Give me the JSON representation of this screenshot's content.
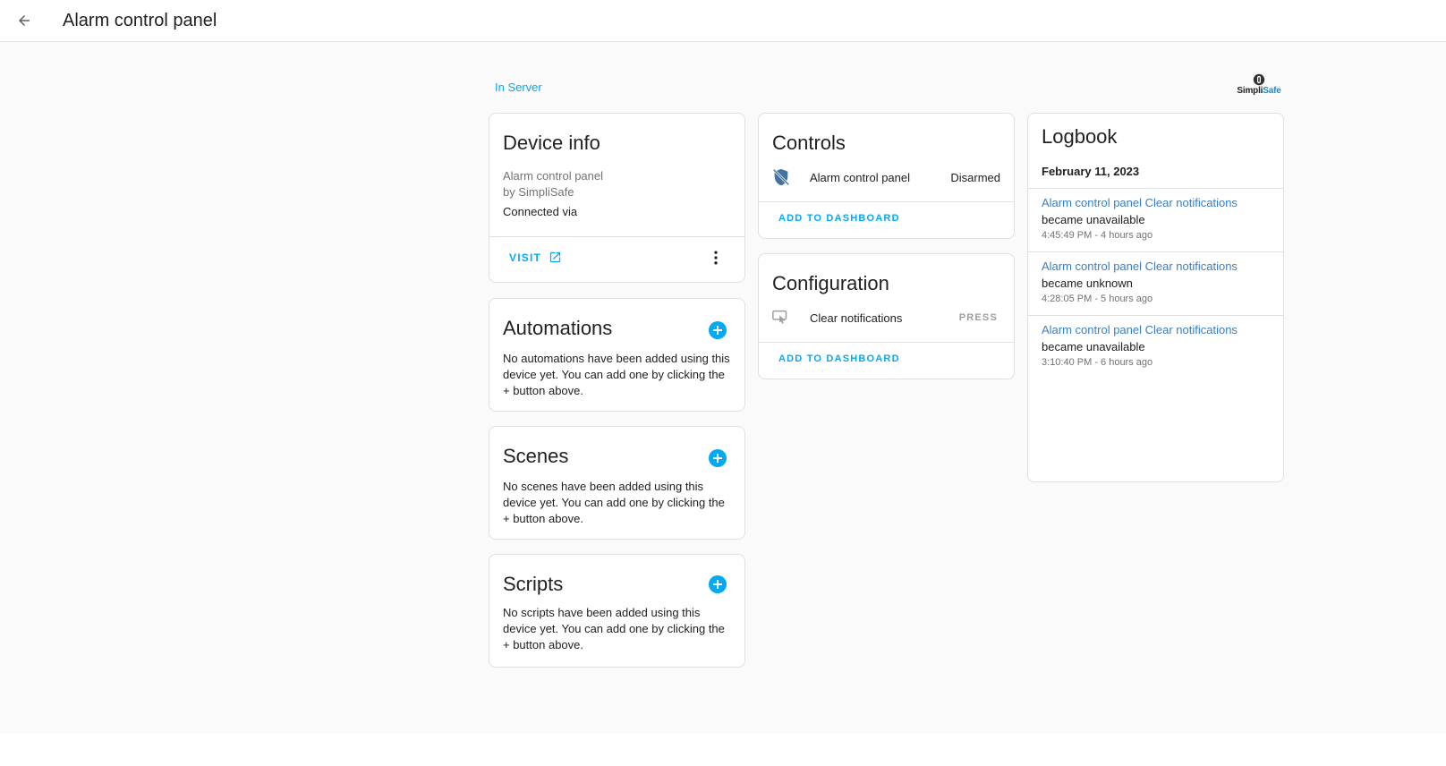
{
  "header": {
    "title": "Alarm control panel"
  },
  "area_link": "In Server",
  "brand": {
    "name_part1": "Simpli",
    "name_part2": "Safe",
    "accent_color": "#1e88c8"
  },
  "device_info": {
    "title": "Device info",
    "model": "Alarm control panel",
    "manufacturer": "by SimpliSafe",
    "connected_via": "Connected via",
    "visit_label": "VISIT"
  },
  "automations": {
    "title": "Automations",
    "empty_text": "No automations have been added using this device yet. You can add one by clicking the + button above."
  },
  "scenes": {
    "title": "Scenes",
    "empty_text": "No scenes have been added using this device yet. You can add one by clicking the + button above."
  },
  "scripts": {
    "title": "Scripts",
    "empty_text": "No scripts have been added using this device yet. You can add one by clicking the + button above."
  },
  "controls": {
    "title": "Controls",
    "entity_name": "Alarm control panel",
    "entity_state": "Disarmed",
    "add_to_dashboard": "ADD TO DASHBOARD"
  },
  "configuration": {
    "title": "Configuration",
    "entity_name": "Clear notifications",
    "press_label": "PRESS",
    "add_to_dashboard": "ADD TO DASHBOARD"
  },
  "logbook": {
    "title": "Logbook",
    "date": "February 11, 2023",
    "entries": [
      {
        "entity": "Alarm control panel Clear notifications",
        "message": "became unavailable",
        "time": "4:45:49 PM - 4 hours ago"
      },
      {
        "entity": "Alarm control panel Clear notifications",
        "message": "became unknown",
        "time": "4:28:05 PM - 5 hours ago"
      },
      {
        "entity": "Alarm control panel Clear notifications",
        "message": "became unavailable",
        "time": "3:10:40 PM - 6 hours ago"
      }
    ]
  },
  "colors": {
    "primary": "#03a9f4",
    "log_link": "#3a7ec2",
    "background": "#fafafa"
  }
}
